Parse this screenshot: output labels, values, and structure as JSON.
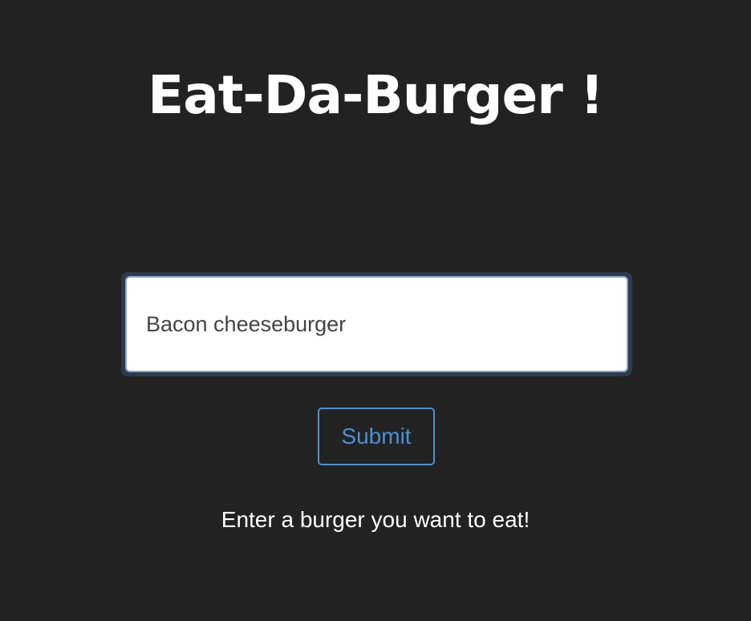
{
  "header": {
    "title": "Eat-Da-Burger !"
  },
  "form": {
    "burger_input_value": "Bacon cheeseburger",
    "submit_label": "Submit",
    "helper_text": "Enter a burger you want to eat!"
  },
  "colors": {
    "background": "#222222",
    "accent": "#4a90d9",
    "text": "#ffffff"
  }
}
